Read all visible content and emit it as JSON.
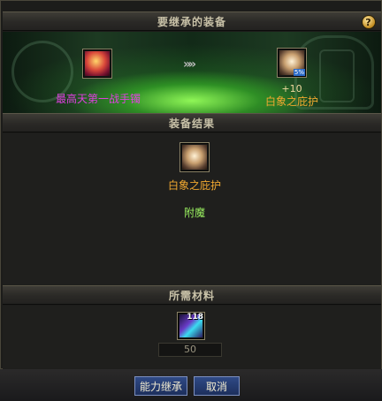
{
  "sections": {
    "inherit_title": "要继承的装备",
    "result_title": "装备结果",
    "materials_title": "所需材料"
  },
  "help_label": "?",
  "source_item": {
    "name": "最高天第一战手镯",
    "icon": "glove-icon",
    "color": "#e040e0"
  },
  "arrows": "»»",
  "target_item": {
    "enhance": "+10",
    "name": "白象之庇护",
    "icon": "shield-icon",
    "badge": "5%",
    "color": "#f0a830"
  },
  "result_item": {
    "name": "白象之庇护",
    "icon": "shield-icon",
    "color": "#f0a830"
  },
  "enchant_label": "附魔",
  "enchant_color": "#9af060",
  "material": {
    "icon": "crystal-icon",
    "quantity": "118",
    "required": "50"
  },
  "buttons": {
    "inherit": "能力继承",
    "cancel": "取消"
  }
}
